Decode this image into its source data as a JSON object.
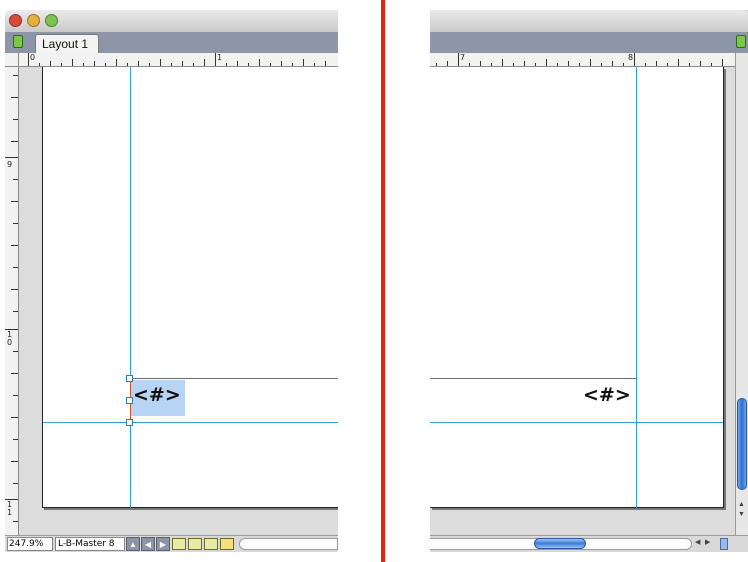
{
  "window": {
    "tab_label": "Layout 1"
  },
  "rulers": {
    "left_h": [
      "0",
      "1"
    ],
    "left_v": [
      "9",
      "1\n0",
      "1\n1"
    ],
    "right_h": [
      "7",
      "8"
    ]
  },
  "page": {
    "page_number_marker": "<#>"
  },
  "statusbar": {
    "zoom": "247.9%",
    "master": "L-B-Master 8"
  },
  "colors": {
    "guide": "#34a0d0",
    "divider": "#e2231a",
    "selection": "#b7d4f5"
  }
}
